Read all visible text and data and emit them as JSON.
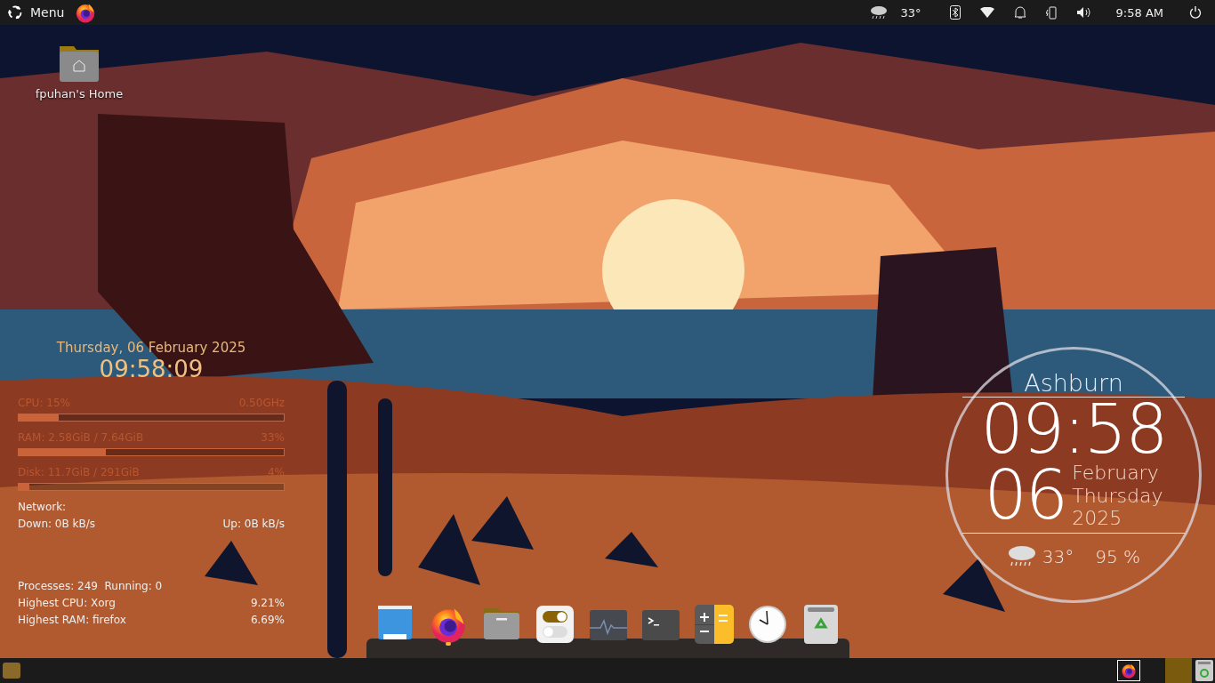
{
  "top_bar": {
    "menu_label": "Menu",
    "weather_temp": "33°",
    "clock": "9:58 AM"
  },
  "desktop_icons": [
    {
      "label": "fpuhan's Home"
    }
  ],
  "system_monitor": {
    "date": "Thursday, 06 February 2025",
    "time": "09:58:09",
    "meters": [
      {
        "label": "CPU: 15%",
        "reading": "0.50GHz",
        "level": 0.15
      },
      {
        "label": "RAM: 2.58GiB / 7.64GiB",
        "reading": "33%",
        "level": 0.33
      },
      {
        "label": "Disk: 11.7GiB / 291GiB",
        "reading": "4%",
        "level": 0.04
      }
    ],
    "network_label": "Network:",
    "down": "Down: 0B kB/s",
    "up": "Up: 0B kB/s",
    "processes": "Processes: 249  Running: 0",
    "top": [
      {
        "label": "Highest CPU: Xorg",
        "value": "9.21%"
      },
      {
        "label": "Highest RAM: firefox",
        "value": "6.69%"
      }
    ]
  },
  "clock_widget": {
    "city": "Ashburn",
    "time": "09:58",
    "day": "06",
    "month": "February",
    "weekday": "Thursday",
    "year": "2025",
    "temp": "33°",
    "humidity": "95 %"
  },
  "dock": [
    {
      "kind": "desktop",
      "running": false
    },
    {
      "kind": "firefox",
      "running": true
    },
    {
      "kind": "files",
      "running": false
    },
    {
      "kind": "settings",
      "running": false
    },
    {
      "kind": "monitor",
      "running": false
    },
    {
      "kind": "terminal",
      "running": false
    },
    {
      "kind": "calculator",
      "running": false
    },
    {
      "kind": "clock",
      "running": false
    },
    {
      "kind": "trash",
      "running": false
    }
  ],
  "taskbar": {
    "tasks": [
      {
        "kind": "firefox",
        "selected": true
      }
    ],
    "workspaces": [
      {
        "selected": true
      }
    ]
  }
}
